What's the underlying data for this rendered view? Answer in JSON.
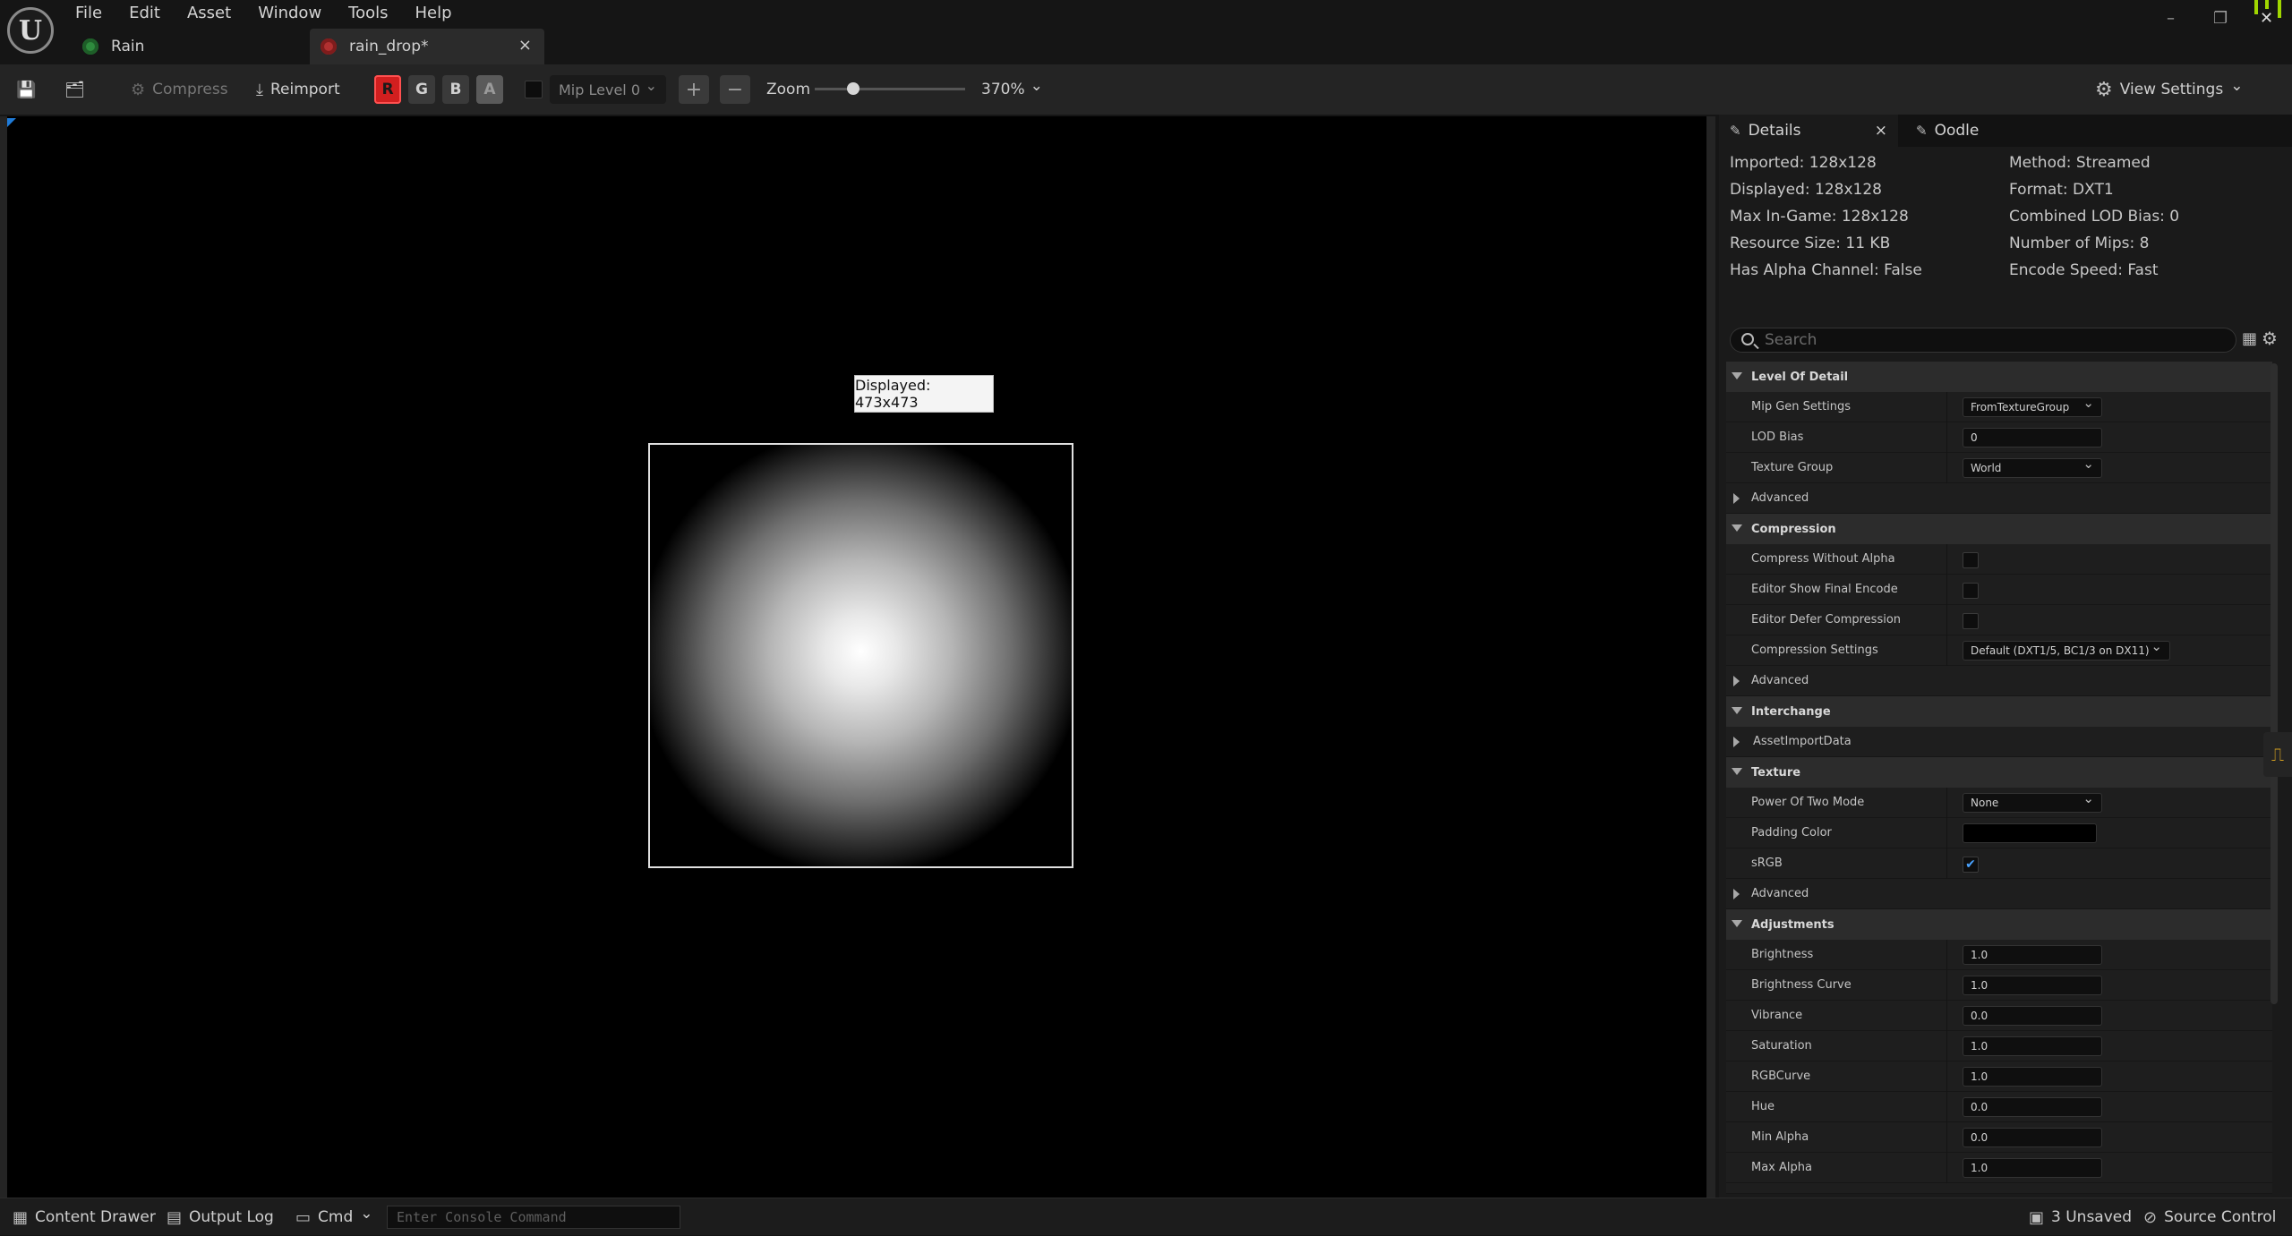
{
  "menu": [
    "File",
    "Edit",
    "Asset",
    "Window",
    "Tools",
    "Help"
  ],
  "tabs": {
    "rain": "Rain",
    "rain_drop": "rain_drop*",
    "close": "×"
  },
  "window_controls": {
    "minimize": "–",
    "restore": "❐",
    "close": "✕"
  },
  "toolbar": {
    "compress": "Compress",
    "reimport": "Reimport",
    "channels": [
      "R",
      "G",
      "B",
      "A"
    ],
    "channel_colors": {
      "R": "#d21f1f",
      "G": "#3a3a3a",
      "B": "#3a3a3a",
      "A": "#5a5a5a"
    },
    "mip_level": "Mip Level 0",
    "plus": "+",
    "minus": "−",
    "zoom_label": "Zoom",
    "zoom_value": "370%",
    "view_settings": "View Settings"
  },
  "viewport": {
    "tooltip": "Displayed: 473x473"
  },
  "details": {
    "tab_details": "Details",
    "tab_close": "×",
    "tab_oodle": "Oodle",
    "info_left": [
      "Imported: 128x128",
      "Displayed: 128x128",
      "Max In-Game: 128x128",
      "Resource Size: 11 KB",
      "Has Alpha Channel: False"
    ],
    "info_right": [
      "Method: Streamed",
      "Format: DXT1",
      "Combined LOD Bias: 0",
      "Number of Mips: 8",
      "Encode Speed: Fast"
    ],
    "search_placeholder": "Search",
    "properties": [
      {
        "kind": "cat",
        "label": "Level Of Detail"
      },
      {
        "kind": "dd",
        "label": "Mip Gen Settings",
        "value": "FromTextureGroup"
      },
      {
        "kind": "input",
        "label": "LOD Bias",
        "value": "0"
      },
      {
        "kind": "dd",
        "label": "Texture Group",
        "value": "World"
      },
      {
        "kind": "sub",
        "label": "Advanced"
      },
      {
        "kind": "cat",
        "label": "Compression"
      },
      {
        "kind": "chk",
        "label": "Compress Without Alpha",
        "value": false
      },
      {
        "kind": "chk",
        "label": "Editor Show Final Encode",
        "value": false
      },
      {
        "kind": "chk",
        "label": "Editor Defer Compression",
        "value": false
      },
      {
        "kind": "dd",
        "label": "Compression Settings",
        "value": "Default (DXT1/5, BC1/3 on DX11)"
      },
      {
        "kind": "sub",
        "label": "Advanced"
      },
      {
        "kind": "cat",
        "label": "Interchange"
      },
      {
        "kind": "sub",
        "label": "AssetImportData"
      },
      {
        "kind": "cat",
        "label": "Texture"
      },
      {
        "kind": "dd",
        "label": "Power Of Two Mode",
        "value": "None"
      },
      {
        "kind": "color",
        "label": "Padding Color",
        "value": "#000000"
      },
      {
        "kind": "chk",
        "label": "sRGB",
        "value": true
      },
      {
        "kind": "sub",
        "label": "Advanced"
      },
      {
        "kind": "cat",
        "label": "Adjustments"
      },
      {
        "kind": "input",
        "label": "Brightness",
        "value": "1.0"
      },
      {
        "kind": "input",
        "label": "Brightness Curve",
        "value": "1.0"
      },
      {
        "kind": "input",
        "label": "Vibrance",
        "value": "0.0"
      },
      {
        "kind": "input",
        "label": "Saturation",
        "value": "1.0"
      },
      {
        "kind": "input",
        "label": "RGBCurve",
        "value": "1.0"
      },
      {
        "kind": "input",
        "label": "Hue",
        "value": "0.0"
      },
      {
        "kind": "input",
        "label": "Min Alpha",
        "value": "0.0"
      },
      {
        "kind": "input",
        "label": "Max Alpha",
        "value": "1.0"
      }
    ]
  },
  "statusbar": {
    "content_drawer": "Content Drawer",
    "output_log": "Output Log",
    "cmd": "Cmd",
    "console_placeholder": "Enter Console Command",
    "unsaved": "3 Unsaved",
    "source_control": "Source Control"
  },
  "icons": {
    "save": "💾",
    "browse": "🗂",
    "compress": "⚙",
    "reimport": "⤓",
    "gear": "⚙",
    "details": "✎",
    "oodle": "✎",
    "content_drawer": "▦",
    "output_log": "▤",
    "cmd": "▭",
    "unsaved": "▣",
    "source_control": "⊘",
    "table": "▦",
    "settings": "⚙"
  }
}
